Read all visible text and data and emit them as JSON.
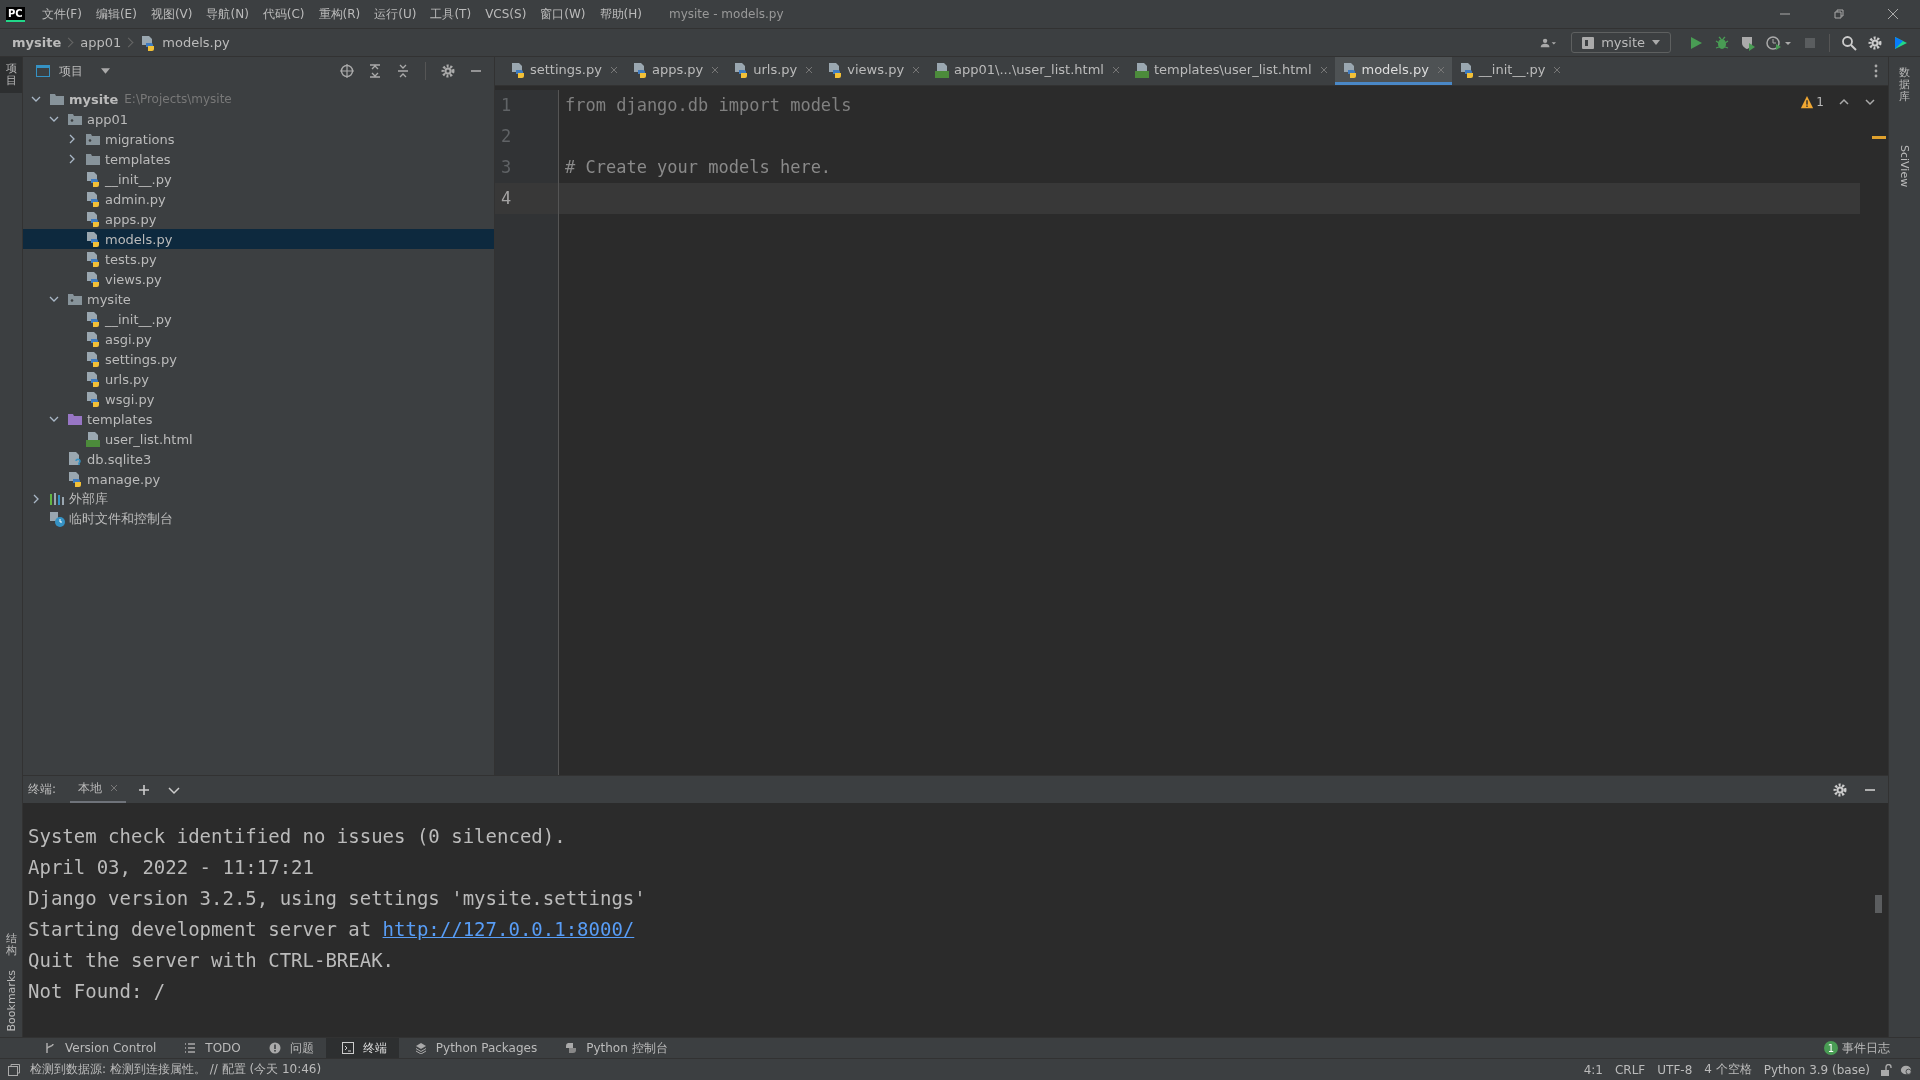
{
  "window": {
    "app_icon": "PC",
    "menu": [
      "文件(F)",
      "编辑(E)",
      "视图(V)",
      "导航(N)",
      "代码(C)",
      "重构(R)",
      "运行(U)",
      "工具(T)",
      "VCS(S)",
      "窗口(W)",
      "帮助(H)"
    ],
    "title": "mysite - models.py"
  },
  "breadcrumb": [
    {
      "label": "mysite",
      "kind": "project"
    },
    {
      "label": "app01",
      "kind": "folder"
    },
    {
      "label": "models.py",
      "kind": "python"
    }
  ],
  "run_config": "mysite",
  "left_strip": {
    "top": [
      {
        "label": "项目",
        "kind": "cjk",
        "selected": true
      }
    ],
    "bottom": [
      {
        "label": "结构",
        "kind": "cjk",
        "selected": false
      },
      {
        "label": "Bookmarks",
        "kind": "latin",
        "selected": false
      }
    ]
  },
  "right_strip": [
    {
      "label": "数据库",
      "kind": "cjk"
    },
    {
      "label": "SciView",
      "kind": "latin"
    }
  ],
  "project_panel": {
    "title": "项目",
    "tree": [
      {
        "label": "mysite",
        "path": "E:\\Projects\\mysite",
        "kind": "folder",
        "expanded": true,
        "selected": false,
        "children": [
          {
            "label": "app01",
            "kind": "package",
            "expanded": true,
            "selected": false,
            "children": [
              {
                "label": "migrations",
                "kind": "package",
                "expanded": false,
                "selected": false
              },
              {
                "label": "templates",
                "kind": "folder",
                "expanded": false,
                "selected": false
              },
              {
                "label": "__init__.py",
                "kind": "python",
                "selected": false
              },
              {
                "label": "admin.py",
                "kind": "python",
                "selected": false
              },
              {
                "label": "apps.py",
                "kind": "python",
                "selected": false
              },
              {
                "label": "models.py",
                "kind": "python",
                "selected": true
              },
              {
                "label": "tests.py",
                "kind": "python",
                "selected": false
              },
              {
                "label": "views.py",
                "kind": "python",
                "selected": false
              }
            ]
          },
          {
            "label": "mysite",
            "kind": "package",
            "expanded": true,
            "selected": false,
            "children": [
              {
                "label": "__init__.py",
                "kind": "python",
                "selected": false
              },
              {
                "label": "asgi.py",
                "kind": "python",
                "selected": false
              },
              {
                "label": "settings.py",
                "kind": "python",
                "selected": false
              },
              {
                "label": "urls.py",
                "kind": "python",
                "selected": false
              },
              {
                "label": "wsgi.py",
                "kind": "python",
                "selected": false
              }
            ]
          },
          {
            "label": "templates",
            "kind": "templates",
            "expanded": true,
            "selected": false,
            "children": [
              {
                "label": "user_list.html",
                "kind": "html",
                "selected": false
              }
            ]
          },
          {
            "label": "db.sqlite3",
            "kind": "unknown",
            "selected": false
          },
          {
            "label": "manage.py",
            "kind": "python",
            "selected": false
          }
        ]
      },
      {
        "label": "外部库",
        "kind": "library",
        "expanded": false,
        "selected": false
      },
      {
        "label": "临时文件和控制台",
        "kind": "scratch",
        "selected": false
      }
    ]
  },
  "editor_tabs": [
    {
      "label": "settings.py",
      "kind": "python",
      "selected": false
    },
    {
      "label": "apps.py",
      "kind": "python",
      "selected": false
    },
    {
      "label": "urls.py",
      "kind": "python",
      "selected": false
    },
    {
      "label": "views.py",
      "kind": "python",
      "selected": false
    },
    {
      "label": "app01\\...\\user_list.html",
      "kind": "html",
      "selected": false
    },
    {
      "label": "templates\\user_list.html",
      "kind": "html",
      "selected": false
    },
    {
      "label": "models.py",
      "kind": "python",
      "selected": true
    },
    {
      "label": "__init__.py",
      "kind": "python",
      "selected": false
    }
  ],
  "editor": {
    "warnings": "1",
    "lines": [
      {
        "number": "1",
        "text": "from django.db import models",
        "kind": "code",
        "current": false
      },
      {
        "number": "2",
        "current": false
      },
      {
        "number": "3",
        "text": "# Create your models here.",
        "kind": "comment",
        "current": false
      },
      {
        "number": "4",
        "current": true
      }
    ]
  },
  "terminal": {
    "title": "终端:",
    "tabs": [
      {
        "label": "本地",
        "selected": true
      }
    ],
    "lines": [
      {
        "text": "System check identified no issues (0 silenced)."
      },
      {
        "text": "April 03, 2022 - 11:17:21"
      },
      {
        "text": "Django version 3.2.5, using settings 'mysite.settings'"
      },
      {
        "text": "Starting development server at ",
        "link": "http://127.0.0.1:8000/"
      },
      {
        "text": "Quit the server with CTRL-BREAK."
      },
      {
        "text": "Not Found: /"
      }
    ]
  },
  "tool_tabs": [
    {
      "label": "Version Control",
      "kind": "vcs",
      "selected": false
    },
    {
      "label": "TODO",
      "kind": "todo",
      "selected": false
    },
    {
      "label": "问题",
      "kind": "problems",
      "selected": false
    },
    {
      "label": "终端",
      "kind": "terminal",
      "selected": true
    },
    {
      "label": "Python Packages",
      "kind": "packages",
      "selected": false
    },
    {
      "label": "Python 控制台",
      "kind": "console",
      "selected": false
    }
  ],
  "event_log": {
    "count": "1",
    "label": "事件日志"
  },
  "status_bar": {
    "message": "检测到数据源: 检测到连接属性。 // 配置 (今天 10:46)",
    "items": [
      "4:1",
      "CRLF",
      "UTF-8",
      "4 个空格",
      "Python 3.9 (base)"
    ]
  }
}
